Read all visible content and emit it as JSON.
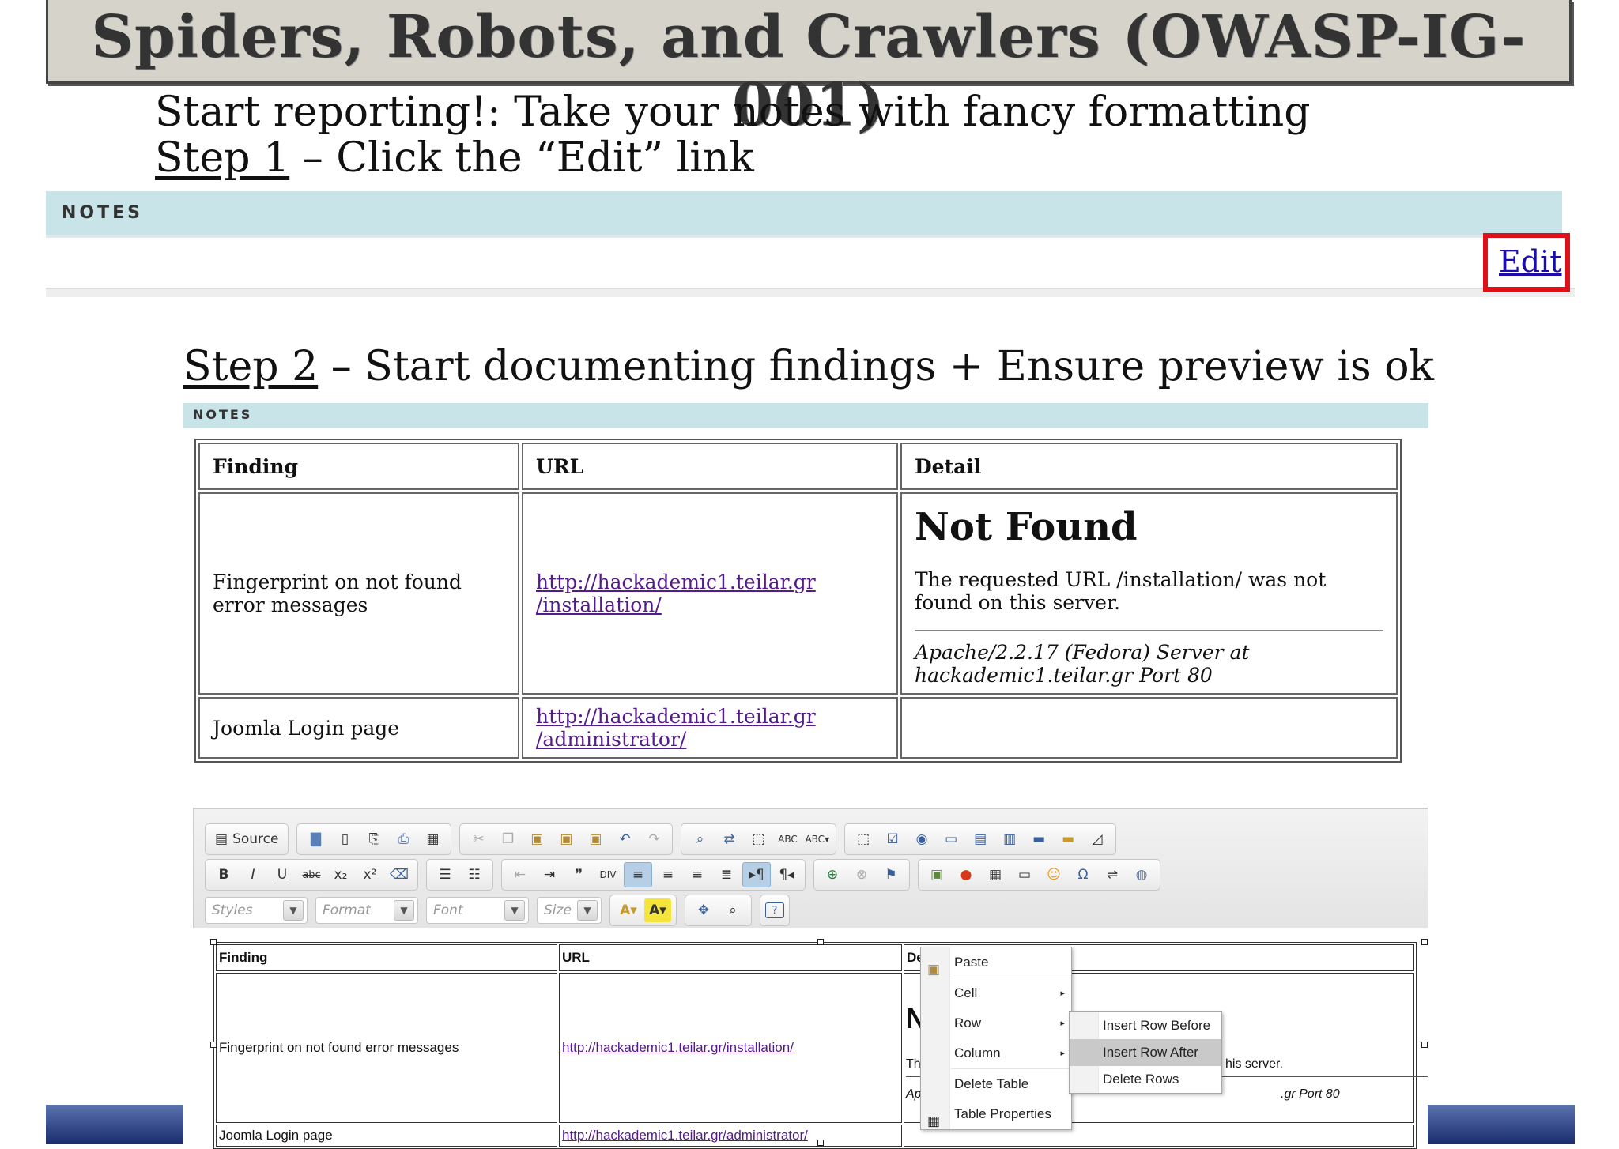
{
  "title": "Spiders, Robots, and Crawlers (OWASP-IG-001)",
  "intro": {
    "line1": "Start reporting!: Take your notes with fancy formatting",
    "step1_label": "Step 1",
    "step1_text": " – Click the “Edit” link",
    "step2_label": "Step 2",
    "step2_text": " – Start documenting findings + Ensure preview is ok"
  },
  "notes_panel": {
    "header": "NOTES",
    "edit_link": "Edit"
  },
  "preview": {
    "header": "NOTES",
    "columns": [
      "Finding",
      "URL",
      "Detail"
    ],
    "rows": [
      {
        "finding": "Fingerprint on not found error messages",
        "url_line1": "http://hackademic1.teilar.gr",
        "url_line2": "/installation/",
        "detail_heading": "Not Found",
        "detail_text": "The requested URL /installation/ was not found on this server.",
        "detail_address": "Apache/2.2.17 (Fedora) Server at hackademic1.teilar.gr Port 80"
      },
      {
        "finding": "Joomla Login page",
        "url_line1": "http://hackademic1.teilar.gr",
        "url_line2": "/administrator/",
        "detail_heading": "",
        "detail_text": "",
        "detail_address": ""
      }
    ]
  },
  "editor": {
    "toolbar": {
      "source_label": "Source",
      "styles_label": "Styles",
      "format_label": "Format",
      "font_label": "Font",
      "size_label": "Size"
    },
    "table": {
      "columns": [
        "Finding",
        "URL",
        "De"
      ],
      "row1_finding": "Fingerprint on not found error messages",
      "row1_url": "http://hackademic1.teilar.gr/installation/",
      "row1_detail_heading": "N",
      "row1_detail_text_start": "The",
      "row1_detail_text_end": "his server.",
      "row1_detail_addr_start": "Ap",
      "row1_detail_addr_end": ".gr Port 80",
      "row2_finding": "Joomla Login page",
      "row2_url": "http://hackademic1.teilar.gr/administrator/"
    },
    "context_menu": {
      "items": [
        "Paste",
        "Cell",
        "Row",
        "Column",
        "Delete Table",
        "Table Properties"
      ]
    },
    "row_submenu": {
      "items": [
        "Insert Row Before",
        "Insert Row After",
        "Delete Rows"
      ]
    }
  },
  "colors": {
    "notes_header": "#c8e4e8",
    "edit_highlight": "#e0101a",
    "link": "#551a8b",
    "footer_band": "#1a2c6b"
  }
}
